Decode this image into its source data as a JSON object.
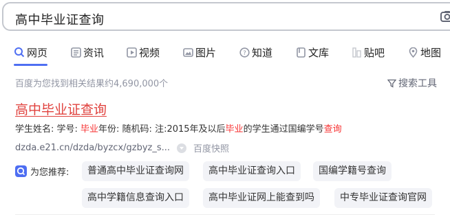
{
  "search": {
    "query": "高中毕业证查询"
  },
  "tabs": [
    {
      "label": "网页",
      "icon": "search-icon",
      "active": true
    },
    {
      "label": "资讯",
      "icon": "news-icon"
    },
    {
      "label": "视频",
      "icon": "video-icon"
    },
    {
      "label": "图片",
      "icon": "image-icon"
    },
    {
      "label": "知道",
      "icon": "question-icon"
    },
    {
      "label": "文库",
      "icon": "document-icon"
    },
    {
      "label": "贴吧",
      "icon": "tieba-icon"
    },
    {
      "label": "地图",
      "icon": "map-icon"
    }
  ],
  "stats": {
    "text": "百度为您找到相关结果约4,690,000个"
  },
  "tools": {
    "label": "搜索工具"
  },
  "result": {
    "title": "高中毕业证查询",
    "snippet": {
      "p1": "学生姓名: 学号: ",
      "h1": "毕业",
      "p2": "年份: 随机码: 注:2015年及以后",
      "h2": "毕业",
      "p3": "的学生通过国编学号",
      "h3": "查询"
    },
    "url": "dzda.e21.cn/dzda/byzcx/gzbyz_s...",
    "cache": "百度快照"
  },
  "recommend": {
    "label": "为您推荐:",
    "items": [
      "普通高中毕业证查询网",
      "高中毕业证查询入口",
      "国编学籍号查询",
      "高中学籍信息查询入口",
      "高中毕业证网上能查到吗",
      "中专毕业证查询官网"
    ]
  },
  "colors": {
    "accent": "#4e6ef2",
    "title": "#e0413d",
    "highlight": "#f73131"
  }
}
